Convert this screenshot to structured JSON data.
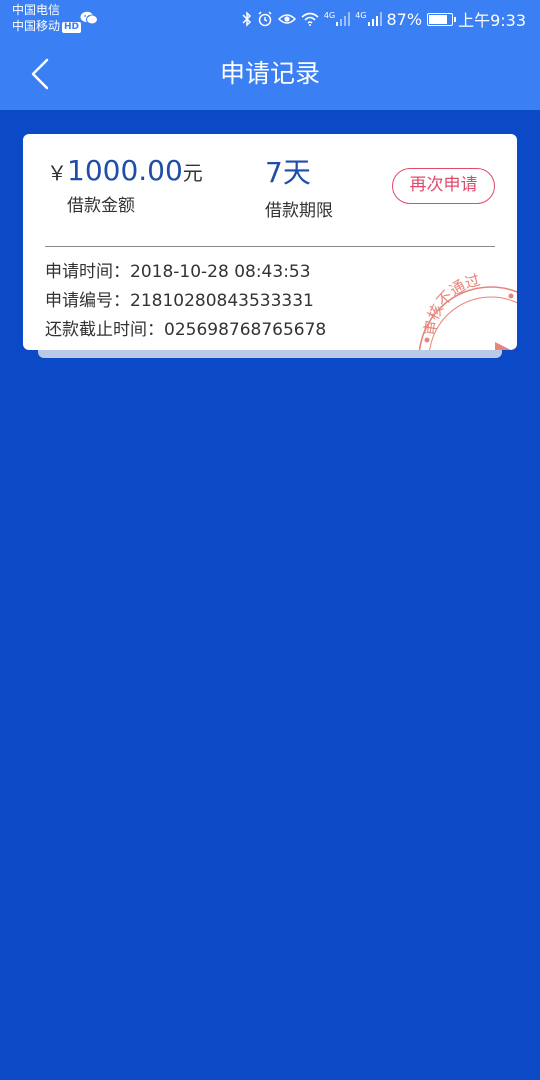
{
  "status_bar": {
    "carrier_1": "中国电信",
    "carrier_2": "中国移动",
    "hd_badge": "HD",
    "net_1": "4G",
    "net_2": "4G",
    "battery": "87%",
    "battery_level": 0.87,
    "time": "上午9:33"
  },
  "header": {
    "title": "申请记录"
  },
  "record": {
    "currency_symbol": "￥",
    "amount": "1000.00",
    "amount_unit": "元",
    "amount_label": "借款金额",
    "term": "7天",
    "term_label": "借款期限",
    "reapply_label": "再次申请",
    "apply_time_label": "申请时间：",
    "apply_time": "2018-10-28 08:43:53",
    "apply_no_label": "申请编号：",
    "apply_no": "21810280843533331",
    "deadline_label": "还款截止时间：",
    "deadline": "025698768765678",
    "stamp_text": "审核不通过"
  },
  "colors": {
    "header_bg": "#3a7ff4",
    "page_bg": "#0b49c7",
    "accent_blue": "#1e4ea8",
    "reject_red": "#e04a6b"
  }
}
